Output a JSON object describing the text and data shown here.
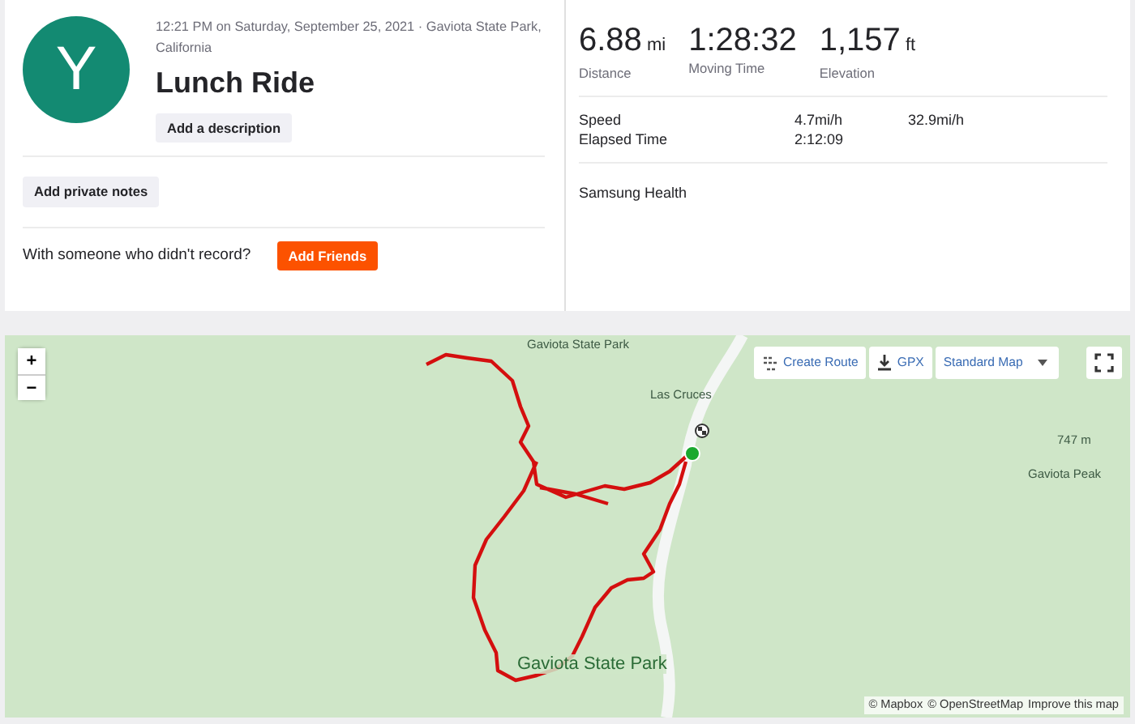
{
  "activity": {
    "avatar_letter": "Y",
    "datetime_location": "12:21 PM on Saturday, September 25, 2021 · Gaviota State Park, California",
    "title": "Lunch Ride",
    "description_button": "Add a description"
  },
  "private_notes_button": "Add private notes",
  "friends": {
    "prompt": "With someone who didn't record?",
    "button": "Add Friends"
  },
  "stats": {
    "primary": [
      {
        "value": "6.88",
        "unit": "mi",
        "label": "Distance"
      },
      {
        "value": "1:28:32",
        "label": "Moving Time"
      },
      {
        "value": "1,157",
        "unit": "ft",
        "label": "Elevation"
      }
    ],
    "secondary": [
      {
        "label": "Speed",
        "values": [
          "4.7mi/h",
          "32.9mi/h"
        ]
      },
      {
        "label": "Elapsed Time",
        "values": [
          "2:12:09"
        ]
      }
    ],
    "device": "Samsung Health"
  },
  "map": {
    "zoom_buttons": [
      "+",
      "−"
    ],
    "toolbar": [
      {
        "kind": "route",
        "label": "Create Route"
      },
      {
        "kind": "download",
        "label": "GPX"
      },
      {
        "kind": "dropdown",
        "label": "Standard Map"
      }
    ],
    "labels": [
      {
        "kind": "park_top",
        "text": "Gaviota State Park"
      },
      {
        "kind": "town",
        "text": "Las Cruces"
      },
      {
        "kind": "peak_elevation",
        "text": "747 m"
      },
      {
        "kind": "peak",
        "text": "Gaviota Peak"
      },
      {
        "kind": "park_large",
        "text": "Gaviota State Park"
      }
    ],
    "attribution": [
      "© Mapbox",
      "© OpenStreetMap",
      "Improve this map"
    ]
  }
}
